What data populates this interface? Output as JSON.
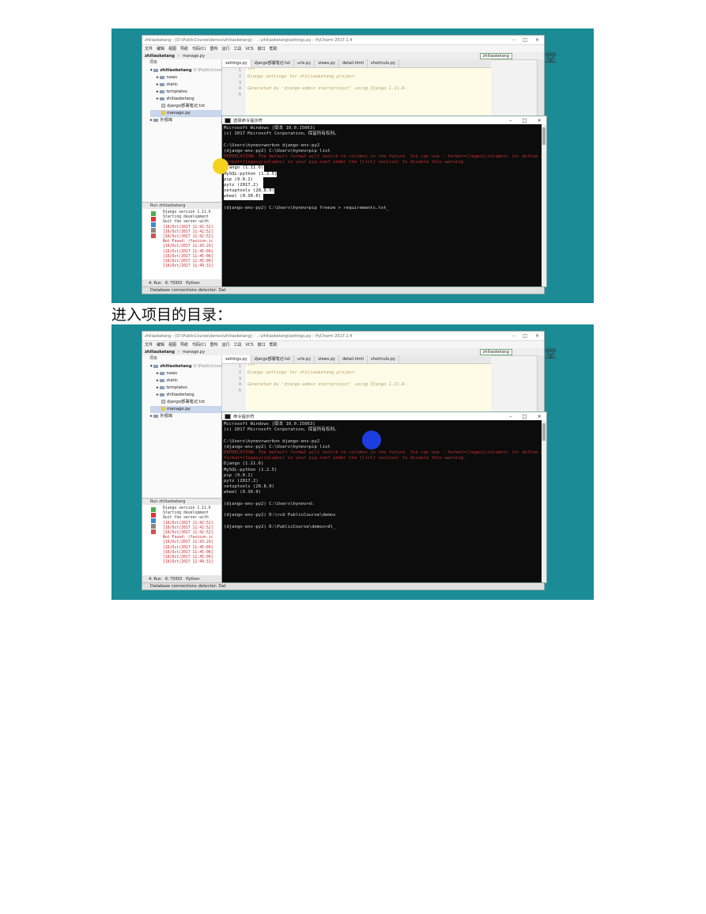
{
  "ide": {
    "title": "zhiliaoketang – [D:\\PublicCourse\\demos\\zhiliaoketang] – ...\\zhiliaoketang\\settings.py – PyCharm 2017.1.4",
    "menu": [
      "文件",
      "编辑",
      "视图",
      "导航",
      "代码(C)",
      "重构",
      "运行",
      "工具",
      "VCS",
      "窗口",
      "帮助"
    ],
    "nav_project": "zhiliaoketang",
    "nav_file": "manage.py",
    "run_config": "zhiliaoketang",
    "project_header": "项目",
    "tree": {
      "root": "zhiliaoketang",
      "root_path": "D:\\PublicCourse\\d",
      "items": [
        "news",
        "static",
        "templates",
        "zhiliaoketang",
        "django部署笔记.txt",
        "manage.py"
      ],
      "external": "外部库"
    },
    "tabs": [
      "settings.py",
      "django部署笔记.txt",
      "urls.py",
      "views.py",
      "detail.html",
      "shortcuts.py"
    ],
    "gutter": [
      "1",
      "2",
      "3",
      "4",
      "5"
    ],
    "code": [
      "\"\"\"",
      "Django settings for zhiliaoketang project.",
      "",
      "Generated by 'django-admin startproject' using Django 1.11.6.",
      ""
    ],
    "run_tab": "zhiliaoketang",
    "run_log": [
      {
        "text": "Django version 1.11.6",
        "color": "blk"
      },
      {
        "text": "Starting development",
        "color": "blk"
      },
      {
        "text": "Quit the server with",
        "color": "blk"
      },
      {
        "text": "[16/Oct/2017 11:42:52]",
        "color": "red"
      },
      {
        "text": "[16/Oct/2017 11:42:52]",
        "color": "red"
      },
      {
        "text": "[16/Oct/2017 11:42:52]",
        "color": "red"
      },
      {
        "text": "Not Found: /favicon.ic",
        "color": "red"
      },
      {
        "text": "[16/Oct/2017 11:43:29]",
        "color": "red"
      },
      {
        "text": "[16/Oct/2017 11:45:09]",
        "color": "red"
      },
      {
        "text": "[16/Oct/2017 11:45:06]",
        "color": "red"
      },
      {
        "text": "[16/Oct/2017 11:45:09]",
        "color": "red"
      },
      {
        "text": "[16/Oct/2017 11:49:31]",
        "color": "red"
      }
    ],
    "bottom_tabs": [
      "4: Run",
      "6: TODO",
      "Python"
    ],
    "status": "Database connections detector: Dat",
    "right_labels": [
      "Database",
      "Path View"
    ]
  },
  "logo_text": "云课堂",
  "shot1": {
    "cmd_title": "选择命令提示符",
    "lines": [
      {
        "text": "Microsoft Windows [版本 10.0.15063]",
        "color": "n"
      },
      {
        "text": "(c) 2017 Microsoft Corporation。保留所有权利。",
        "color": "n"
      },
      {
        "text": "",
        "color": "n"
      },
      {
        "text": "C:\\Users\\hynev>workon django-env-py2",
        "color": "n"
      },
      {
        "text": "(django-env-py2) C:\\Users\\hynev>pip list",
        "color": "n"
      },
      {
        "text": "DEPRECATION: The default format will switch to columns in the future. You can use --format=(legacy|columns) (or define a",
        "color": "red"
      },
      {
        "text": "format=(legacy|columns) in your pip.conf under the [list] section) to disable this warning.",
        "color": "red"
      },
      {
        "text": "Django (1.11.6)",
        "color": "sel"
      },
      {
        "text": "MySQL-python (1.2.5)",
        "color": "sel"
      },
      {
        "text": "pip (9.0.1)",
        "color": "sel"
      },
      {
        "text": "pytz (2017.2)",
        "color": "sel"
      },
      {
        "text": "setuptools (28.8.0)",
        "color": "sel"
      },
      {
        "text": "wheel (0.30.0)",
        "color": "sel"
      },
      {
        "text": "",
        "color": "n"
      },
      {
        "text": "(django-env-py2) C:\\Users\\hynev>pip freeze > requirements.txt_",
        "color": "n"
      }
    ]
  },
  "caption": "进入项目的目录：",
  "shot2": {
    "cmd_title": "命令提示符",
    "lines": [
      {
        "text": "Microsoft Windows [版本 10.0.15063]",
        "color": "n"
      },
      {
        "text": "(c) 2017 Microsoft Corporation。保留所有权利。",
        "color": "n"
      },
      {
        "text": "",
        "color": "n"
      },
      {
        "text": "C:\\Users\\hynev>workon django-env-py2",
        "color": "n"
      },
      {
        "text": "(django-env-py2) C:\\Users\\hynev>pip list",
        "color": "n"
      },
      {
        "text": "DEPRECATION: The default format will switch to columns in the future. You can use --format=(legacy|columns) (or define a",
        "color": "red"
      },
      {
        "text": "format=(legacy|columns) in your pip.conf under the [list] section) to disable this warning.",
        "color": "red"
      },
      {
        "text": "Django (1.11.6)",
        "color": "n"
      },
      {
        "text": "MySQL-python (1.2.5)",
        "color": "n"
      },
      {
        "text": "pip (9.0.1)",
        "color": "n"
      },
      {
        "text": "pytz (2017.2)",
        "color": "n"
      },
      {
        "text": "setuptools (28.8.0)",
        "color": "n"
      },
      {
        "text": "wheel (0.30.0)",
        "color": "n"
      },
      {
        "text": "",
        "color": "n"
      },
      {
        "text": "(django-env-py2) C:\\Users\\hynev>d:",
        "color": "n"
      },
      {
        "text": "",
        "color": "n"
      },
      {
        "text": "(django-env-py2) D:\\>cd PublicCourse\\demos",
        "color": "n"
      },
      {
        "text": "",
        "color": "n"
      },
      {
        "text": "(django-env-py2) D:\\PublicCourse\\demos>dl_",
        "color": "n"
      }
    ]
  },
  "colors": {
    "bg": "#1b8b96",
    "terminal": "#0c0c0c",
    "terminal_text": "#d8d8d8",
    "warning": "#c03030"
  }
}
